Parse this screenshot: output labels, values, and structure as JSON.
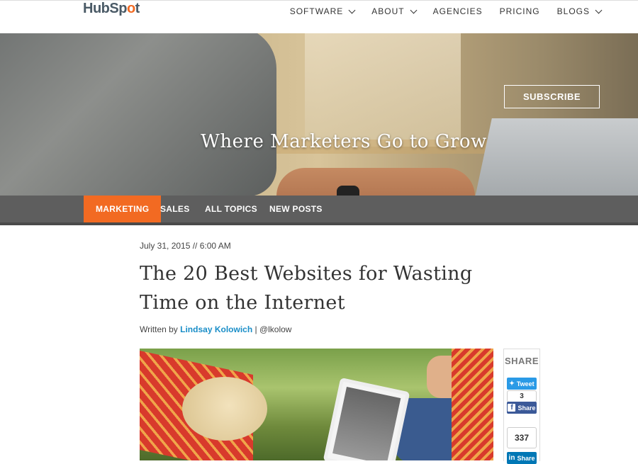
{
  "brand": {
    "logo_pre": "HubSp",
    "logo_o": "o",
    "logo_post": "t"
  },
  "nav": {
    "software": "SOFTWARE",
    "about": "ABOUT",
    "agencies": "AGENCIES",
    "pricing": "PRICING",
    "blogs": "BLOGS"
  },
  "hero": {
    "tagline": "Where Marketers Go to Grow",
    "subscribe": "SUBSCRIBE"
  },
  "categories": {
    "marketing": "MARKETING",
    "sales": "SALES",
    "all_topics": "ALL TOPICS",
    "new_posts": "NEW POSTS"
  },
  "article": {
    "date": "July 31, 2015 // 6:00 AM",
    "title": "The 20 Best Websites for Wasting Time on the Internet",
    "byline_prefix": "Written by ",
    "author": "Lindsay Kolowich",
    "handle": " | @lkolow"
  },
  "share": {
    "title": "SHARE",
    "tweet": "Tweet",
    "facebook_count": "3",
    "facebook_label": "Share",
    "linkedin_count": "337",
    "linkedin_label": "Share"
  },
  "colors": {
    "accent": "#f26a22",
    "link": "#1a8ec8",
    "twitter": "#2a9ae6",
    "facebook": "#3b5998",
    "linkedin": "#0077b5"
  }
}
